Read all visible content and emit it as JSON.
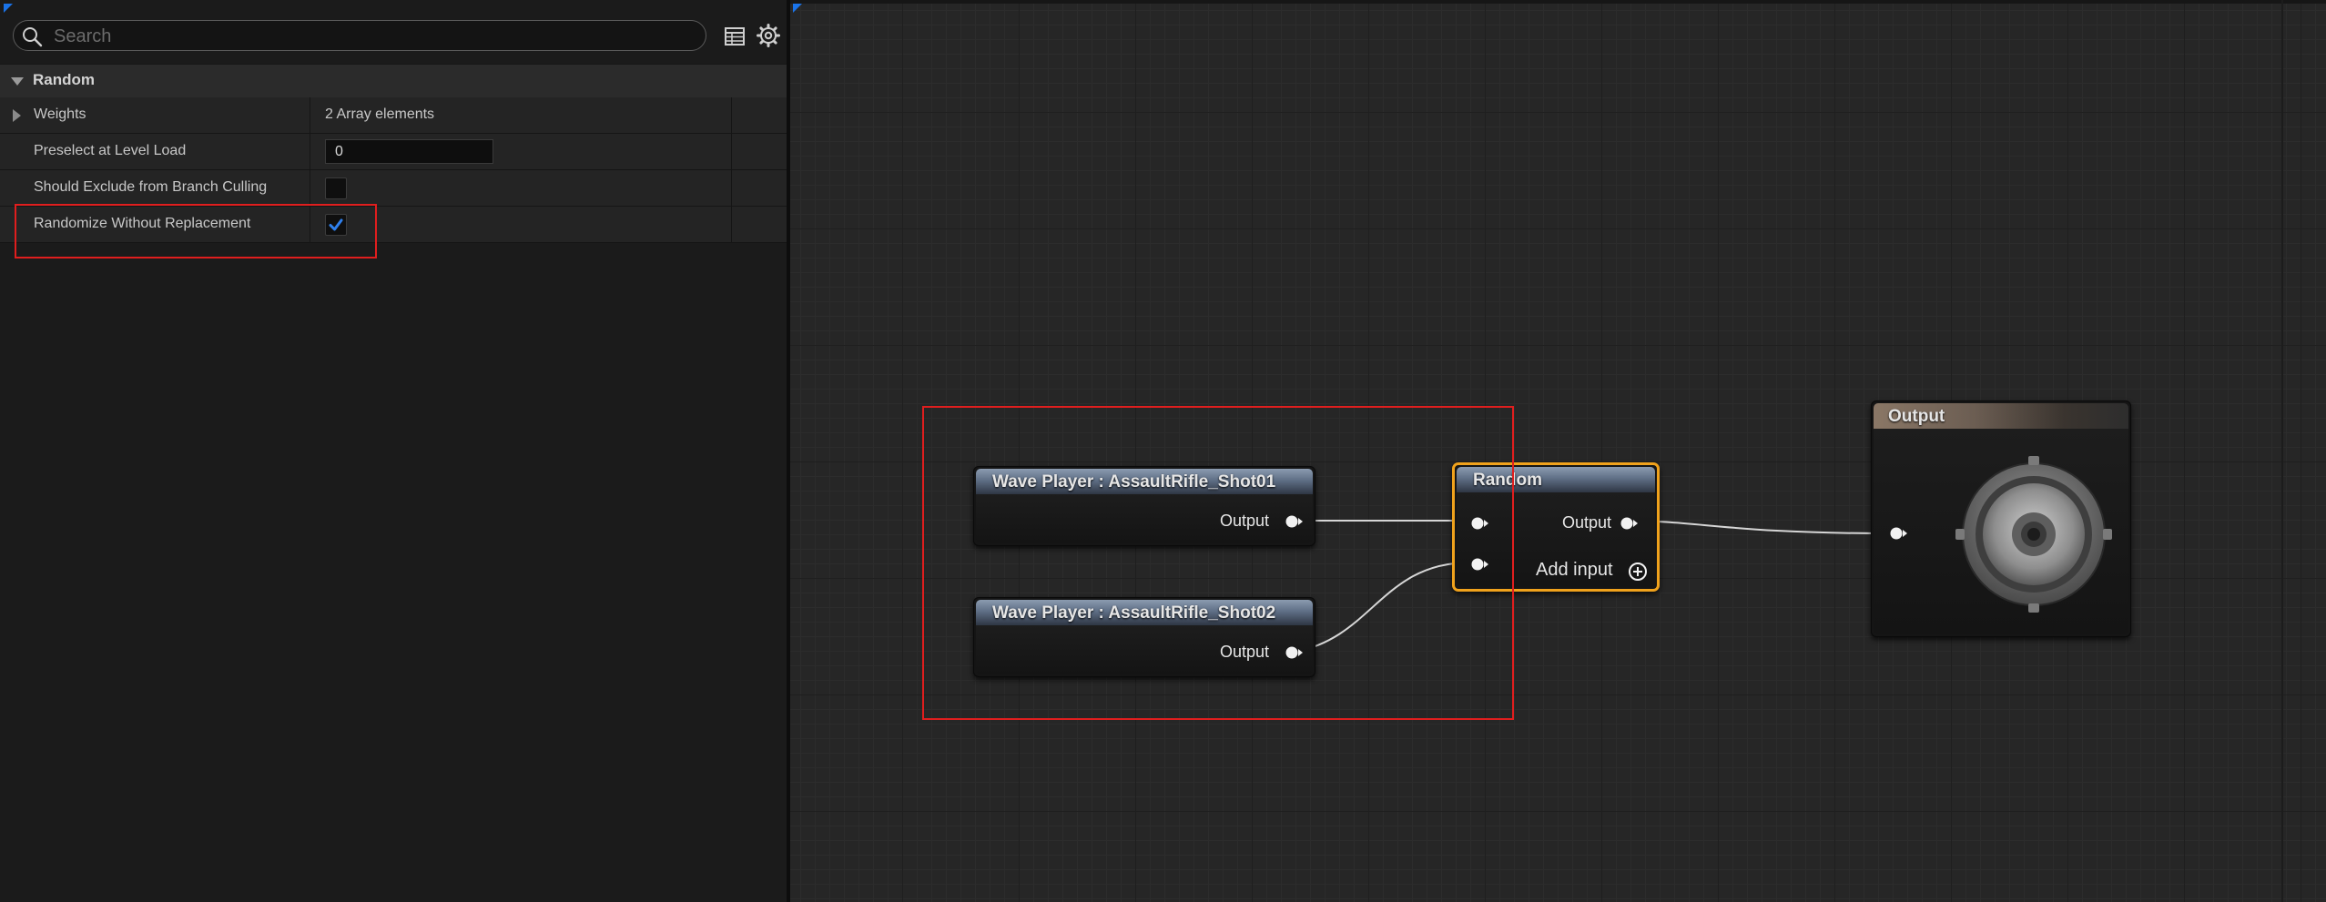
{
  "details": {
    "search_placeholder": "Search",
    "table_view_icon": "table-view-icon",
    "settings_icon": "gear-icon",
    "category": "Random",
    "properties": [
      {
        "name": "Weights",
        "value": "2 Array elements"
      },
      {
        "name": "Preselect at Level Load",
        "value": "0"
      },
      {
        "name": "Should Exclude from Branch Culling",
        "checked": false
      },
      {
        "name": "Randomize Without Replacement",
        "checked": true
      }
    ]
  },
  "graph": {
    "nodes": {
      "wave1": {
        "title": "Wave Player : AssaultRifle_Shot01",
        "output_label": "Output"
      },
      "wave2": {
        "title": "Wave Player : AssaultRifle_Shot02",
        "output_label": "Output"
      },
      "random": {
        "title": "Random",
        "output_label": "Output",
        "add_input_label": "Add input"
      },
      "output": {
        "title": "Output",
        "icon": "speaker-icon"
      }
    }
  },
  "colors": {
    "selection_outline": "#f0a21c",
    "annotation_red": "#e01e1e",
    "checkbox_accent": "#2f80ed"
  }
}
